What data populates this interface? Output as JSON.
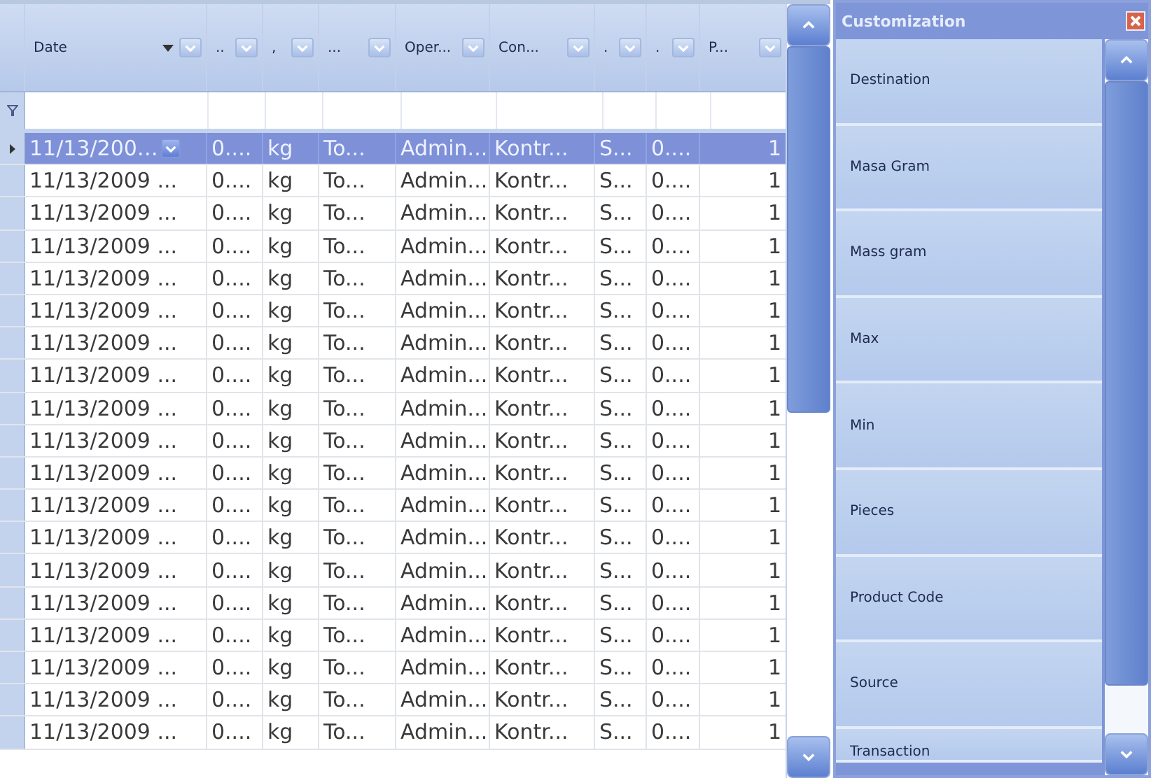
{
  "grid": {
    "columns": [
      {
        "label": "Date",
        "sorted_descending": true
      },
      {
        "label": ".."
      },
      {
        "label": ","
      },
      {
        "label": "..."
      },
      {
        "label": "Oper..."
      },
      {
        "label": "Con..."
      },
      {
        "label": "."
      },
      {
        "label": "."
      },
      {
        "label": "P..."
      }
    ],
    "rows": [
      {
        "selected": true,
        "cells": [
          "11/13/200…",
          "0....",
          "kg",
          "To...",
          "Admin...",
          "Kontr...",
          "S...",
          "0....",
          "1"
        ]
      },
      {
        "selected": false,
        "cells": [
          "11/13/2009 ...",
          "0....",
          "kg",
          "To...",
          "Admin...",
          "Kontr...",
          "S...",
          "0....",
          "1"
        ]
      },
      {
        "selected": false,
        "cells": [
          "11/13/2009 ...",
          "0....",
          "kg",
          "To...",
          "Admin...",
          "Kontr...",
          "S...",
          "0....",
          "1"
        ]
      },
      {
        "selected": false,
        "cells": [
          "11/13/2009 ...",
          "0....",
          "kg",
          "To...",
          "Admin...",
          "Kontr...",
          "S...",
          "0....",
          "1"
        ]
      },
      {
        "selected": false,
        "cells": [
          "11/13/2009 ...",
          "0....",
          "kg",
          "To...",
          "Admin...",
          "Kontr...",
          "S...",
          "0....",
          "1"
        ]
      },
      {
        "selected": false,
        "cells": [
          "11/13/2009 ...",
          "0....",
          "kg",
          "To...",
          "Admin...",
          "Kontr...",
          "S...",
          "0....",
          "1"
        ]
      },
      {
        "selected": false,
        "cells": [
          "11/13/2009 ...",
          "0....",
          "kg",
          "To...",
          "Admin...",
          "Kontr...",
          "S...",
          "0....",
          "1"
        ]
      },
      {
        "selected": false,
        "cells": [
          "11/13/2009 ...",
          "0....",
          "kg",
          "To...",
          "Admin...",
          "Kontr...",
          "S...",
          "0....",
          "1"
        ]
      },
      {
        "selected": false,
        "cells": [
          "11/13/2009 ...",
          "0....",
          "kg",
          "To...",
          "Admin...",
          "Kontr...",
          "S...",
          "0....",
          "1"
        ]
      },
      {
        "selected": false,
        "cells": [
          "11/13/2009 ...",
          "0....",
          "kg",
          "To...",
          "Admin...",
          "Kontr...",
          "S...",
          "0....",
          "1"
        ]
      },
      {
        "selected": false,
        "cells": [
          "11/13/2009 ...",
          "0....",
          "kg",
          "To...",
          "Admin...",
          "Kontr...",
          "S...",
          "0....",
          "1"
        ]
      },
      {
        "selected": false,
        "cells": [
          "11/13/2009 ...",
          "0....",
          "kg",
          "To...",
          "Admin...",
          "Kontr...",
          "S...",
          "0....",
          "1"
        ]
      },
      {
        "selected": false,
        "cells": [
          "11/13/2009 ...",
          "0....",
          "kg",
          "To...",
          "Admin...",
          "Kontr...",
          "S...",
          "0....",
          "1"
        ]
      },
      {
        "selected": false,
        "cells": [
          "11/13/2009 ...",
          "0....",
          "kg",
          "To...",
          "Admin...",
          "Kontr...",
          "S...",
          "0....",
          "1"
        ]
      },
      {
        "selected": false,
        "cells": [
          "11/13/2009 ...",
          "0....",
          "kg",
          "To...",
          "Admin...",
          "Kontr...",
          "S...",
          "0....",
          "1"
        ]
      },
      {
        "selected": false,
        "cells": [
          "11/13/2009 ...",
          "0....",
          "kg",
          "To...",
          "Admin...",
          "Kontr...",
          "S...",
          "0....",
          "1"
        ]
      },
      {
        "selected": false,
        "cells": [
          "11/13/2009 ...",
          "0....",
          "kg",
          "To...",
          "Admin...",
          "Kontr...",
          "S...",
          "0....",
          "1"
        ]
      },
      {
        "selected": false,
        "cells": [
          "11/13/2009 ...",
          "0....",
          "kg",
          "To...",
          "Admin...",
          "Kontr...",
          "S...",
          "0....",
          "1"
        ]
      },
      {
        "selected": false,
        "cells": [
          "11/13/2009 ...",
          "0....",
          "kg",
          "To...",
          "Admin...",
          "Kontr...",
          "S...",
          "0....",
          "1"
        ]
      }
    ]
  },
  "customization": {
    "title": "Customization",
    "items": [
      "Destination",
      "Masa Gram",
      "Mass gram",
      "Max",
      "Min",
      "Pieces",
      "Product Code",
      "Source",
      "Transaction"
    ]
  }
}
